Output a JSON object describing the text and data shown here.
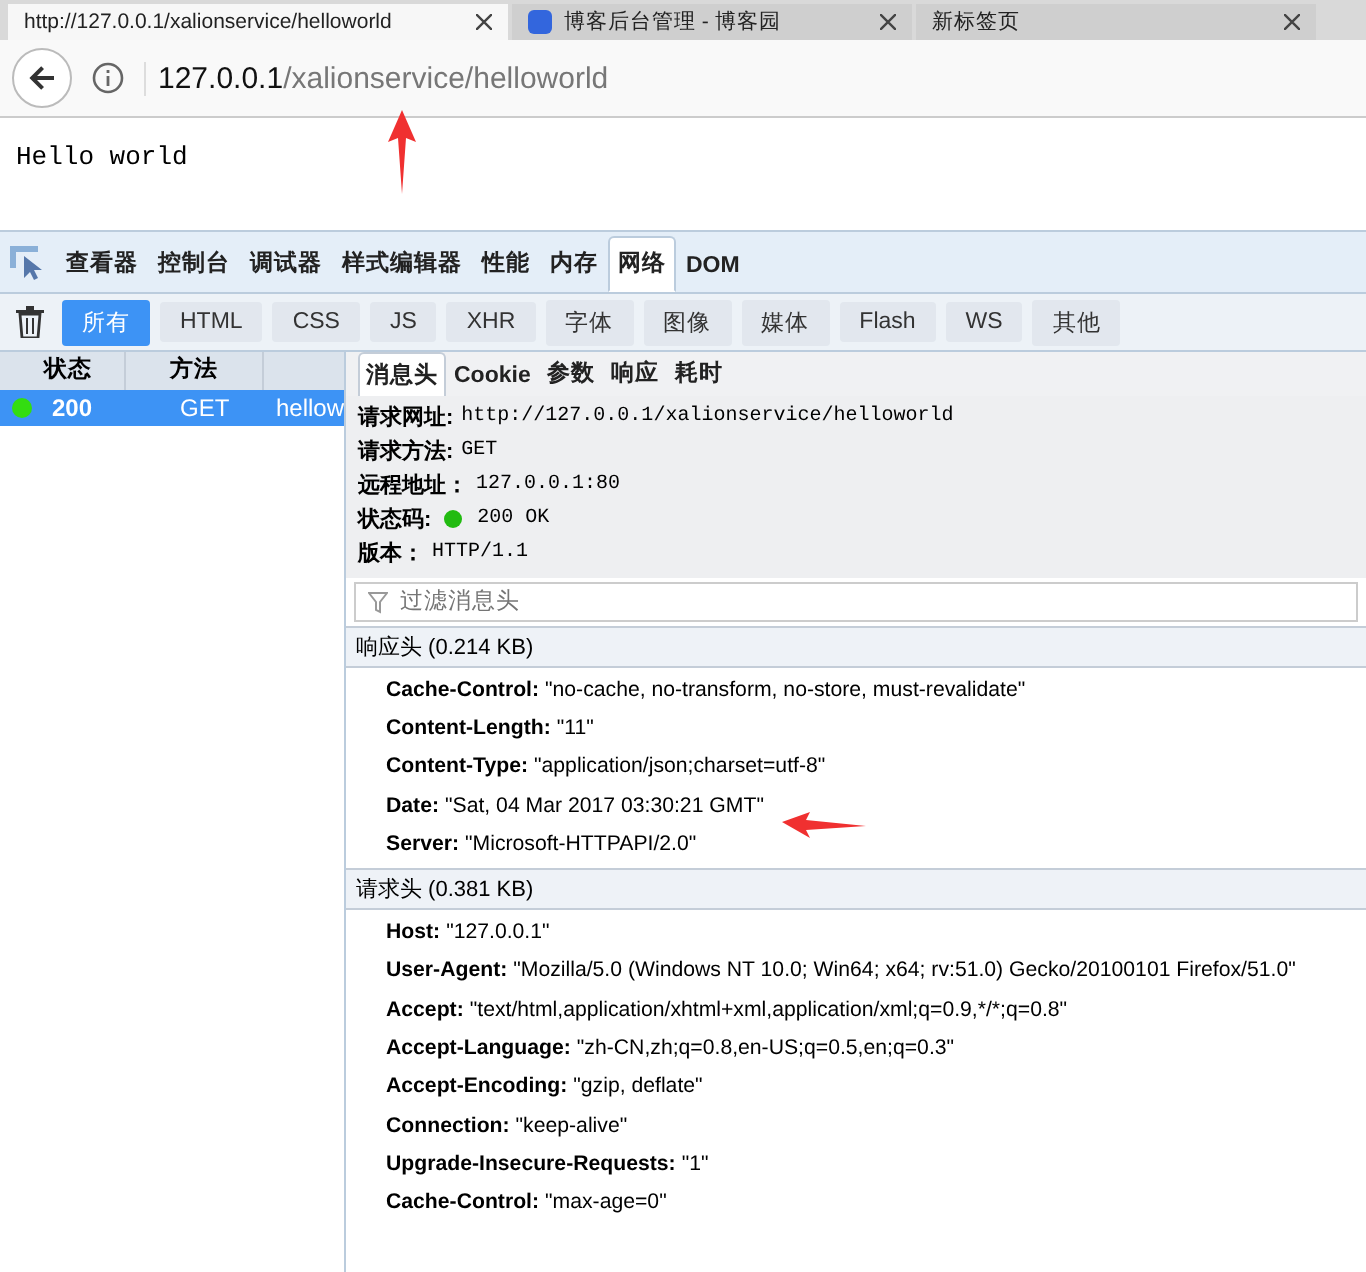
{
  "browser_tabs": [
    {
      "title": "http://127.0.0.1/xalionservice/helloworld",
      "selected": true
    },
    {
      "title": "博客后台管理 - 博客园",
      "selected": false
    },
    {
      "title": "新标签页",
      "selected": false
    }
  ],
  "address_bar": {
    "host": "127.0.0.1",
    "path": "/xalionservice/helloworld"
  },
  "page": {
    "text": "Hello world"
  },
  "devtools": {
    "tools": [
      {
        "label": "查看器",
        "selected": false
      },
      {
        "label": "控制台",
        "selected": false
      },
      {
        "label": "调试器",
        "selected": false
      },
      {
        "label": "样式编辑器",
        "selected": false
      },
      {
        "label": "性能",
        "selected": false
      },
      {
        "label": "内存",
        "selected": false
      },
      {
        "label": "网络",
        "selected": true
      },
      {
        "label": "DOM",
        "selected": false
      }
    ],
    "filters": [
      {
        "label": "所有",
        "selected": true
      },
      {
        "label": "HTML",
        "selected": false
      },
      {
        "label": "CSS",
        "selected": false
      },
      {
        "label": "JS",
        "selected": false
      },
      {
        "label": "XHR",
        "selected": false
      },
      {
        "label": "字体",
        "selected": false
      },
      {
        "label": "图像",
        "selected": false
      },
      {
        "label": "媒体",
        "selected": false
      },
      {
        "label": "Flash",
        "selected": false
      },
      {
        "label": "WS",
        "selected": false
      },
      {
        "label": "其他",
        "selected": false
      }
    ],
    "request_list": {
      "columns": [
        "状态",
        "方法"
      ],
      "rows": [
        {
          "status": "200",
          "method": "GET",
          "file": "hellow",
          "color": "#33dd11",
          "selected": true
        }
      ]
    },
    "detail_tabs": [
      {
        "label": "消息头",
        "selected": true
      },
      {
        "label": "Cookie",
        "selected": false
      },
      {
        "label": "参数",
        "selected": false
      },
      {
        "label": "响应",
        "selected": false
      },
      {
        "label": "耗时",
        "selected": false
      }
    ],
    "summary": [
      {
        "label": "请求网址:",
        "value": "http://127.0.0.1/xalionservice/helloworld"
      },
      {
        "label": "请求方法:",
        "value": "GET"
      },
      {
        "label": "远程地址：",
        "value": "127.0.0.1:80"
      },
      {
        "label": "状态码:",
        "value": "200 OK",
        "color": "#22bb11"
      },
      {
        "label": "版本：",
        "value": "HTTP/1.1"
      }
    ],
    "header_filter": {
      "placeholder": "过滤消息头"
    },
    "sections": [
      {
        "title": "响应头 (0.214 KB)",
        "headers": [
          {
            "name": "Cache-Control:",
            "value": "\"no-cache, no-transform, no-store, must-revalidate\""
          },
          {
            "name": "Content-Length:",
            "value": "\"11\""
          },
          {
            "name": "Content-Type:",
            "value": "\"application/json;charset=utf-8\""
          },
          {
            "name": "Date:",
            "value": "\"Sat, 04 Mar 2017 03:30:21 GMT\""
          },
          {
            "name": "Server:",
            "value": "\"Microsoft-HTTPAPI/2.0\""
          }
        ]
      },
      {
        "title": "请求头 (0.381 KB)",
        "headers": [
          {
            "name": "Host:",
            "value": "\"127.0.0.1\""
          },
          {
            "name": "User-Agent:",
            "value": "\"Mozilla/5.0 (Windows NT 10.0; Win64; x64; rv:51.0) Gecko/20100101 Firefox/51.0\""
          },
          {
            "name": "Accept:",
            "value": "\"text/html,application/xhtml+xml,application/xml;q=0.9,*/*;q=0.8\""
          },
          {
            "name": "Accept-Language:",
            "value": "\"zh-CN,zh;q=0.8,en-US;q=0.5,en;q=0.3\""
          },
          {
            "name": "Accept-Encoding:",
            "value": "\"gzip, deflate\""
          },
          {
            "name": "Connection:",
            "value": "\"keep-alive\""
          },
          {
            "name": "Upgrade-Insecure-Requests:",
            "value": "\"1\""
          },
          {
            "name": "Cache-Control:",
            "value": "\"max-age=0\""
          }
        ]
      }
    ]
  }
}
